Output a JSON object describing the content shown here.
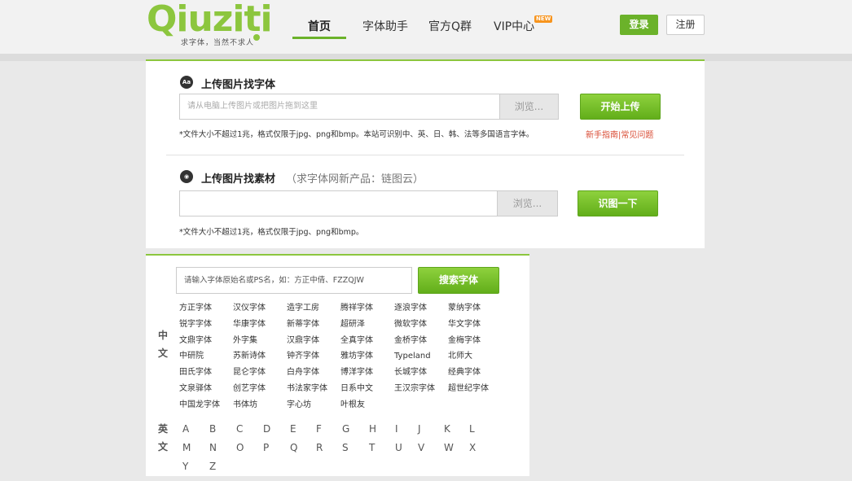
{
  "header": {
    "logo_text": "Qiuziti",
    "logo_slogan": "求字体，当然不求人",
    "nav": {
      "home": "首页",
      "assistant": "字体助手",
      "qgroup": "官方Q群",
      "vip": "VIP中心",
      "vip_badge": "NEW"
    },
    "login": "登录",
    "register": "注册"
  },
  "upload_font": {
    "title": "上传图片找字体",
    "placeholder": "请从电脑上传图片或把图片拖到这里",
    "browse": "浏览...",
    "button": "开始上传",
    "note": "*文件大小不超过1兆，格式仅限于jpg、png和bmp。本站可识别中、英、日、韩、法等多国语言字体。",
    "guide_link": "新手指南",
    "faq_link": "常见问题",
    "link_sep": "|"
  },
  "upload_material": {
    "title": "上传图片找素材",
    "subtitle": "（求字体网新产品：链图云）",
    "browse": "浏览...",
    "button": "识图一下",
    "note": "*文件大小不超过1兆，格式仅限于jpg、png和bmp。"
  },
  "font_search": {
    "placeholder": "请输入字体原始名或PS名，如：方正中倩、FZZQJW",
    "button": "搜索字体",
    "chinese_label": [
      "中",
      "文"
    ],
    "english_label": [
      "英",
      "文"
    ],
    "chinese_rows": [
      [
        "方正字体",
        "汉仪字体",
        "造字工房",
        "腾祥字体",
        "逐浪字体",
        "蒙纳字体"
      ],
      [
        "锐字字体",
        "华康字体",
        "新蒂字体",
        "超研泽",
        "微软字体",
        "华文字体"
      ],
      [
        "文鼎字体",
        "外字集",
        "汉鼎字体",
        "全真字体",
        "金桥字体",
        "金梅字体"
      ],
      [
        "中研院",
        "苏新诗体",
        "钟齐字体",
        "雅坊字体",
        "Typeland",
        "北师大"
      ],
      [
        "田氏字体",
        "昆仑字体",
        "白舟字体",
        "博洋字体",
        "长城字体",
        "经典字体"
      ],
      [
        "文泉驿体",
        "创艺字体",
        "书法家字体",
        "日系中文",
        "王汉宗字体",
        "超世纪字体"
      ],
      [
        "中国龙字体",
        "书体坊",
        "字心坊",
        "叶根友"
      ]
    ],
    "letter_rows": [
      [
        "A",
        "B",
        "C",
        "D",
        "E",
        "F",
        "G",
        "H",
        "I",
        "J",
        "K",
        "L"
      ],
      [
        "M",
        "N",
        "O",
        "P",
        "Q",
        "R",
        "S",
        "T",
        "U",
        "V",
        "W",
        "X"
      ],
      [
        "Y",
        "Z"
      ]
    ]
  },
  "colors": {
    "brand_green": "#8cc63e",
    "button_green": "#6bb22a",
    "link_red": "#d94c35"
  }
}
